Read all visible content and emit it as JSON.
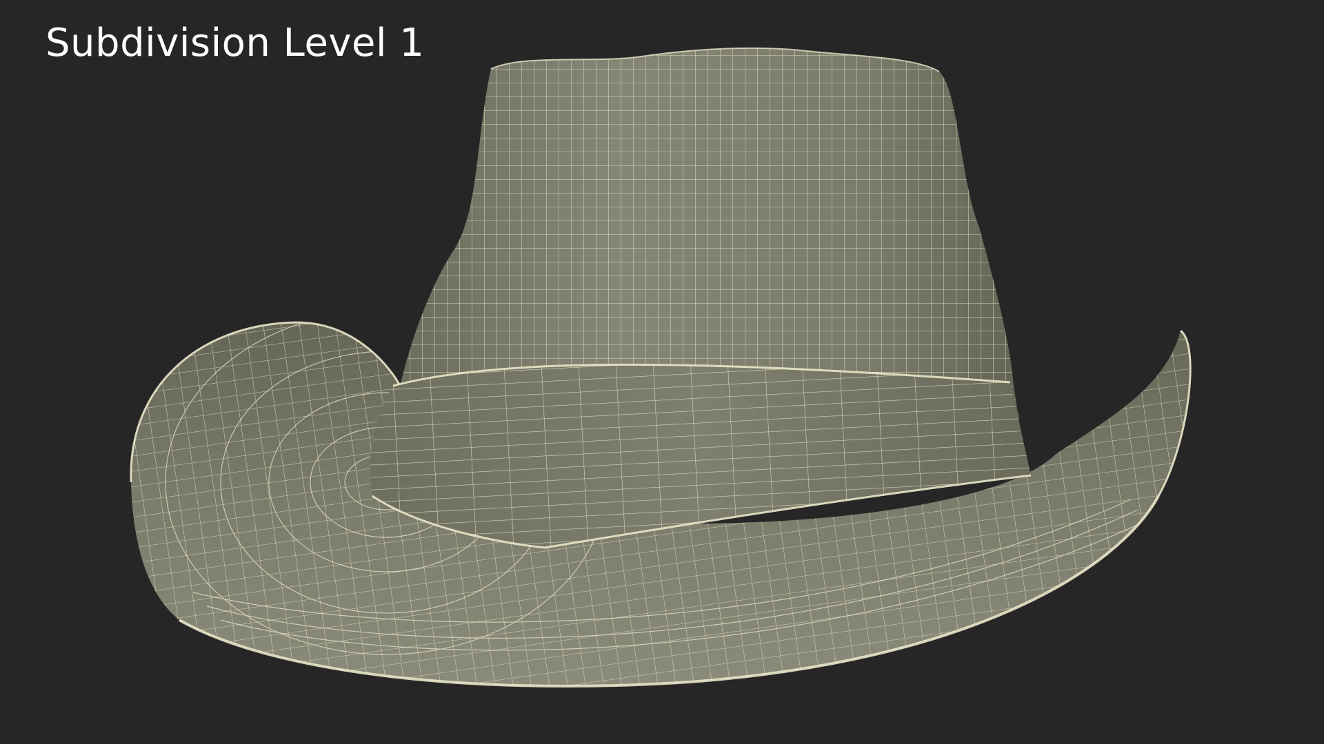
{
  "caption": "Subdivision Level 1",
  "colors": {
    "background": "#262626",
    "caption": "#ffffff",
    "surface": "#7c7d6c",
    "surface_dark": "#5f6052",
    "wire": "#e9e6c9"
  }
}
